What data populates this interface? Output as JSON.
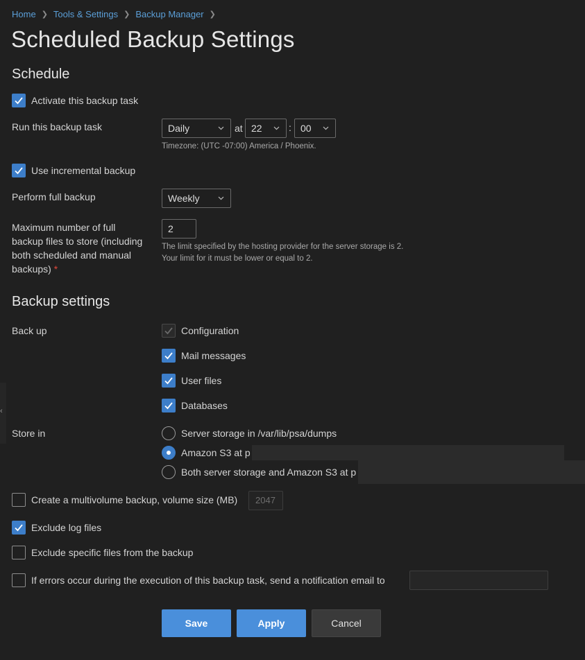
{
  "breadcrumb": [
    "Home",
    "Tools & Settings",
    "Backup Manager"
  ],
  "page_title": "Scheduled Backup Settings",
  "schedule": {
    "heading": "Schedule",
    "activate_label": "Activate this backup task",
    "activate_checked": true,
    "run_label": "Run this backup task",
    "frequency": "Daily",
    "at_label": "at",
    "hour": "22",
    "time_sep": ":",
    "minute": "00",
    "timezone": "Timezone: (UTC -07:00) America / Phoenix.",
    "incremental_label": "Use incremental backup",
    "incremental_checked": true,
    "full_backup_label": "Perform full backup",
    "full_backup_value": "Weekly",
    "max_files_label_lines": [
      "Maximum number of full",
      "backup files to store (including",
      "both scheduled and manual",
      "backups)"
    ],
    "required_mark": "*",
    "max_files_value": "2",
    "max_files_hint_lines": [
      "The limit specified by the hosting provider for the server storage is 2.",
      "Your limit for it must be lower or equal to 2."
    ]
  },
  "backup_settings": {
    "heading": "Backup settings",
    "backup_label": "Back up",
    "items": [
      {
        "label": "Configuration",
        "checked": true,
        "disabled": true
      },
      {
        "label": "Mail messages",
        "checked": true,
        "disabled": false
      },
      {
        "label": "User files",
        "checked": true,
        "disabled": false
      },
      {
        "label": "Databases",
        "checked": true,
        "disabled": false
      }
    ],
    "store_in_label": "Store in",
    "store_options": [
      {
        "label": "Server storage in /var/lib/psa/dumps",
        "selected": false
      },
      {
        "label": "Amazon S3 at p",
        "selected": true
      },
      {
        "label": "Both server storage and Amazon S3 at p",
        "selected": false
      }
    ],
    "multivolume_label": "Create a multivolume backup, volume size (MB)",
    "multivolume_checked": false,
    "volume_size": "2047",
    "exclude_logs_label": "Exclude log files",
    "exclude_logs_checked": true,
    "exclude_specific_label": "Exclude specific files from the backup",
    "exclude_specific_checked": false,
    "notify_label": "If errors occur during the execution of this backup task, send a notification email to",
    "notify_checked": false
  },
  "buttons": {
    "save": "Save",
    "apply": "Apply",
    "cancel": "Cancel"
  },
  "colors": {
    "accent": "#3d7ec9",
    "button_primary": "#4a8fdb",
    "background": "#202020",
    "link": "#5b9fd8",
    "required": "#e0483c"
  },
  "icons": {
    "checkmark": "check-icon",
    "dropdown": "chevron-down-icon",
    "breadcrumb_sep": "chevron-right-icon",
    "side_handle": "chevron-left-icon"
  }
}
